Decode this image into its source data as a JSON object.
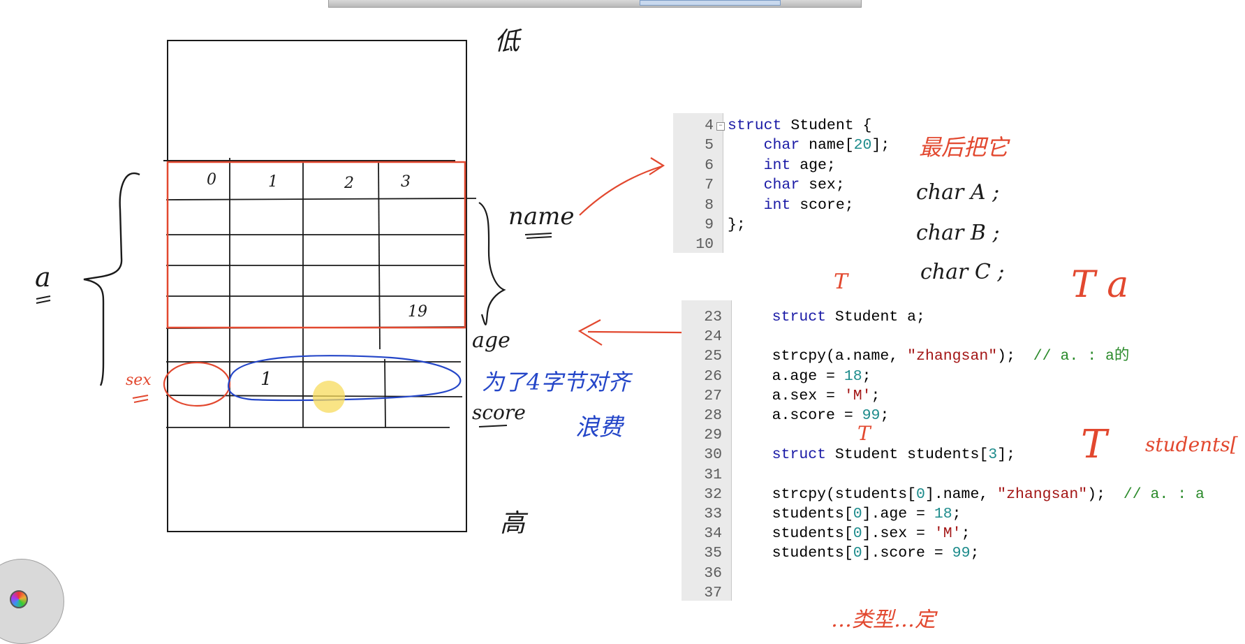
{
  "code_top": {
    "lines": [
      {
        "n": "4",
        "fold": true,
        "parts": [
          {
            "t": "struct",
            "c": "kw"
          },
          {
            "t": " Student {",
            "c": ""
          }
        ]
      },
      {
        "n": "5",
        "parts": [
          {
            "t": "    ",
            "c": ""
          },
          {
            "t": "char",
            "c": "kw"
          },
          {
            "t": " name[",
            "c": ""
          },
          {
            "t": "20",
            "c": "num"
          },
          {
            "t": "];",
            "c": ""
          }
        ]
      },
      {
        "n": "6",
        "parts": [
          {
            "t": "    ",
            "c": ""
          },
          {
            "t": "int",
            "c": "kw"
          },
          {
            "t": " age;",
            "c": ""
          }
        ]
      },
      {
        "n": "7",
        "parts": [
          {
            "t": "    ",
            "c": ""
          },
          {
            "t": "char",
            "c": "kw"
          },
          {
            "t": " sex;",
            "c": ""
          }
        ]
      },
      {
        "n": "8",
        "parts": [
          {
            "t": "    ",
            "c": ""
          },
          {
            "t": "int",
            "c": "kw"
          },
          {
            "t": " score;",
            "c": ""
          }
        ]
      },
      {
        "n": "9",
        "parts": [
          {
            "t": "};",
            "c": ""
          }
        ]
      },
      {
        "n": "10",
        "parts": []
      }
    ]
  },
  "code_bottom": {
    "lines": [
      {
        "n": "23",
        "parts": [
          {
            "t": "    ",
            "c": ""
          },
          {
            "t": "struct",
            "c": "kw"
          },
          {
            "t": " Student a;",
            "c": ""
          }
        ]
      },
      {
        "n": "24",
        "parts": []
      },
      {
        "n": "25",
        "parts": [
          {
            "t": "    strcpy(a.name, ",
            "c": ""
          },
          {
            "t": "\"zhangsan\"",
            "c": "str"
          },
          {
            "t": ");  ",
            "c": ""
          },
          {
            "t": "// a. : a的",
            "c": "cmt"
          }
        ]
      },
      {
        "n": "26",
        "parts": [
          {
            "t": "    a.age = ",
            "c": ""
          },
          {
            "t": "18",
            "c": "num"
          },
          {
            "t": ";",
            "c": ""
          }
        ]
      },
      {
        "n": "27",
        "parts": [
          {
            "t": "    a.sex = ",
            "c": ""
          },
          {
            "t": "'M'",
            "c": "chr"
          },
          {
            "t": ";",
            "c": ""
          }
        ]
      },
      {
        "n": "28",
        "parts": [
          {
            "t": "    a.score = ",
            "c": ""
          },
          {
            "t": "99",
            "c": "num"
          },
          {
            "t": ";",
            "c": ""
          }
        ]
      },
      {
        "n": "29",
        "parts": []
      },
      {
        "n": "30",
        "parts": [
          {
            "t": "    ",
            "c": ""
          },
          {
            "t": "struct",
            "c": "kw"
          },
          {
            "t": " Student students[",
            "c": ""
          },
          {
            "t": "3",
            "c": "num"
          },
          {
            "t": "];",
            "c": ""
          }
        ]
      },
      {
        "n": "31",
        "parts": []
      },
      {
        "n": "32",
        "parts": [
          {
            "t": "    strcpy(students[",
            "c": ""
          },
          {
            "t": "0",
            "c": "num"
          },
          {
            "t": "].name, ",
            "c": ""
          },
          {
            "t": "\"zhangsan\"",
            "c": "str"
          },
          {
            "t": ");  ",
            "c": ""
          },
          {
            "t": "// a. : a",
            "c": "cmt"
          }
        ]
      },
      {
        "n": "33",
        "parts": [
          {
            "t": "    students[",
            "c": ""
          },
          {
            "t": "0",
            "c": "num"
          },
          {
            "t": "].age = ",
            "c": ""
          },
          {
            "t": "18",
            "c": "num"
          },
          {
            "t": ";",
            "c": ""
          }
        ]
      },
      {
        "n": "34",
        "parts": [
          {
            "t": "    students[",
            "c": ""
          },
          {
            "t": "0",
            "c": "num"
          },
          {
            "t": "].sex = ",
            "c": ""
          },
          {
            "t": "'M'",
            "c": "chr"
          },
          {
            "t": ";",
            "c": ""
          }
        ]
      },
      {
        "n": "35",
        "parts": [
          {
            "t": "    students[",
            "c": ""
          },
          {
            "t": "0",
            "c": "num"
          },
          {
            "t": "].score = ",
            "c": ""
          },
          {
            "t": "99",
            "c": "num"
          },
          {
            "t": ";",
            "c": ""
          }
        ]
      },
      {
        "n": "36",
        "parts": []
      },
      {
        "n": "37",
        "parts": []
      }
    ]
  },
  "handwriting": {
    "top_label": "低",
    "bottom_label": "高",
    "a_label": "a",
    "cell_0": "0",
    "cell_1": "1",
    "cell_2": "2",
    "cell_3": "3",
    "cell_19": "19",
    "cell_one": "1",
    "name_label": "name",
    "age_label": "age",
    "sex_label": "sex",
    "score_label": "score",
    "align_note": "为了4字节对齐",
    "waste_note": "浪费",
    "best_note": "最后把它",
    "char_a": "char A ;",
    "char_b": "char B ;",
    "char_c": "char C ;",
    "t_mark_1": "T",
    "t_mark_2": "T",
    "t_a": "T a",
    "t_students": "T",
    "students_note": "students[",
    "bottom_note": "…类型…定"
  },
  "colors": {
    "ink_black": "#1a1a1a",
    "ink_red": "#e2482f",
    "ink_blue": "#2446c8",
    "keyword": "#1a1aa6",
    "number": "#1e8c8c",
    "string": "#a31515",
    "comment": "#2a8a2a"
  }
}
